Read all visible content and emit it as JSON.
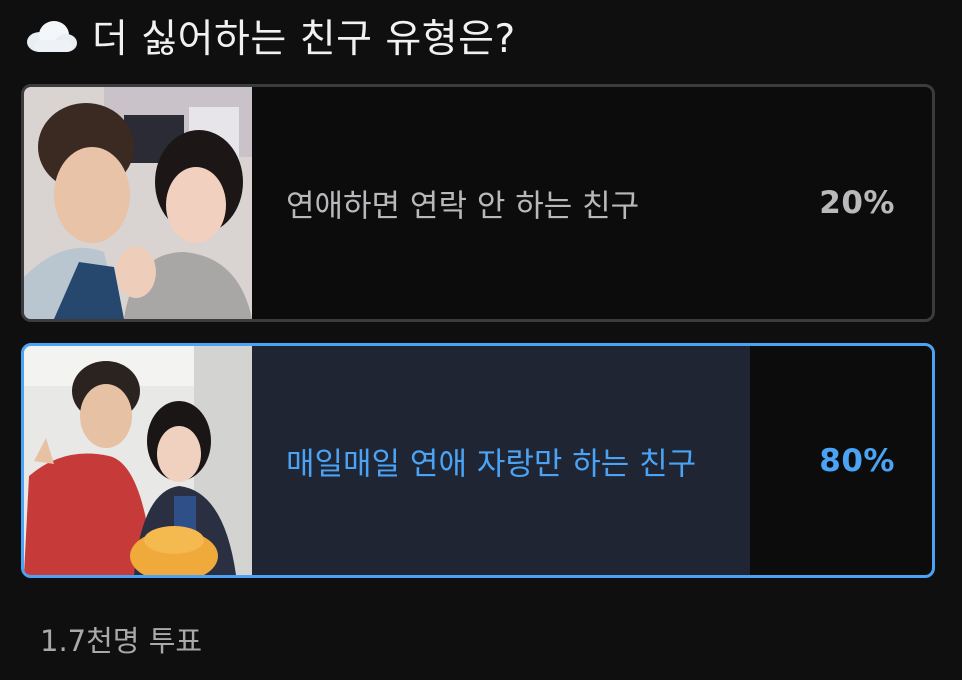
{
  "poll": {
    "title": "더 싫어하는 친구 유형은?",
    "title_icon": "cloud-icon",
    "options": [
      {
        "label": "연애하면 연락 안 하는 친구",
        "percent": "20%",
        "fraction": 0.2,
        "selected": false
      },
      {
        "label": "매일매일 연애 자랑만 하는 친구",
        "percent": "80%",
        "fraction": 0.8,
        "selected": true
      }
    ],
    "vote_count": "1.7천명 투표"
  },
  "colors": {
    "background": "#0f0f10",
    "selected_accent": "#4aa3f5",
    "unselected_text": "#b9b9bb",
    "unselected_fill": "#3a3a3c",
    "selected_fill": "#1f2533"
  }
}
